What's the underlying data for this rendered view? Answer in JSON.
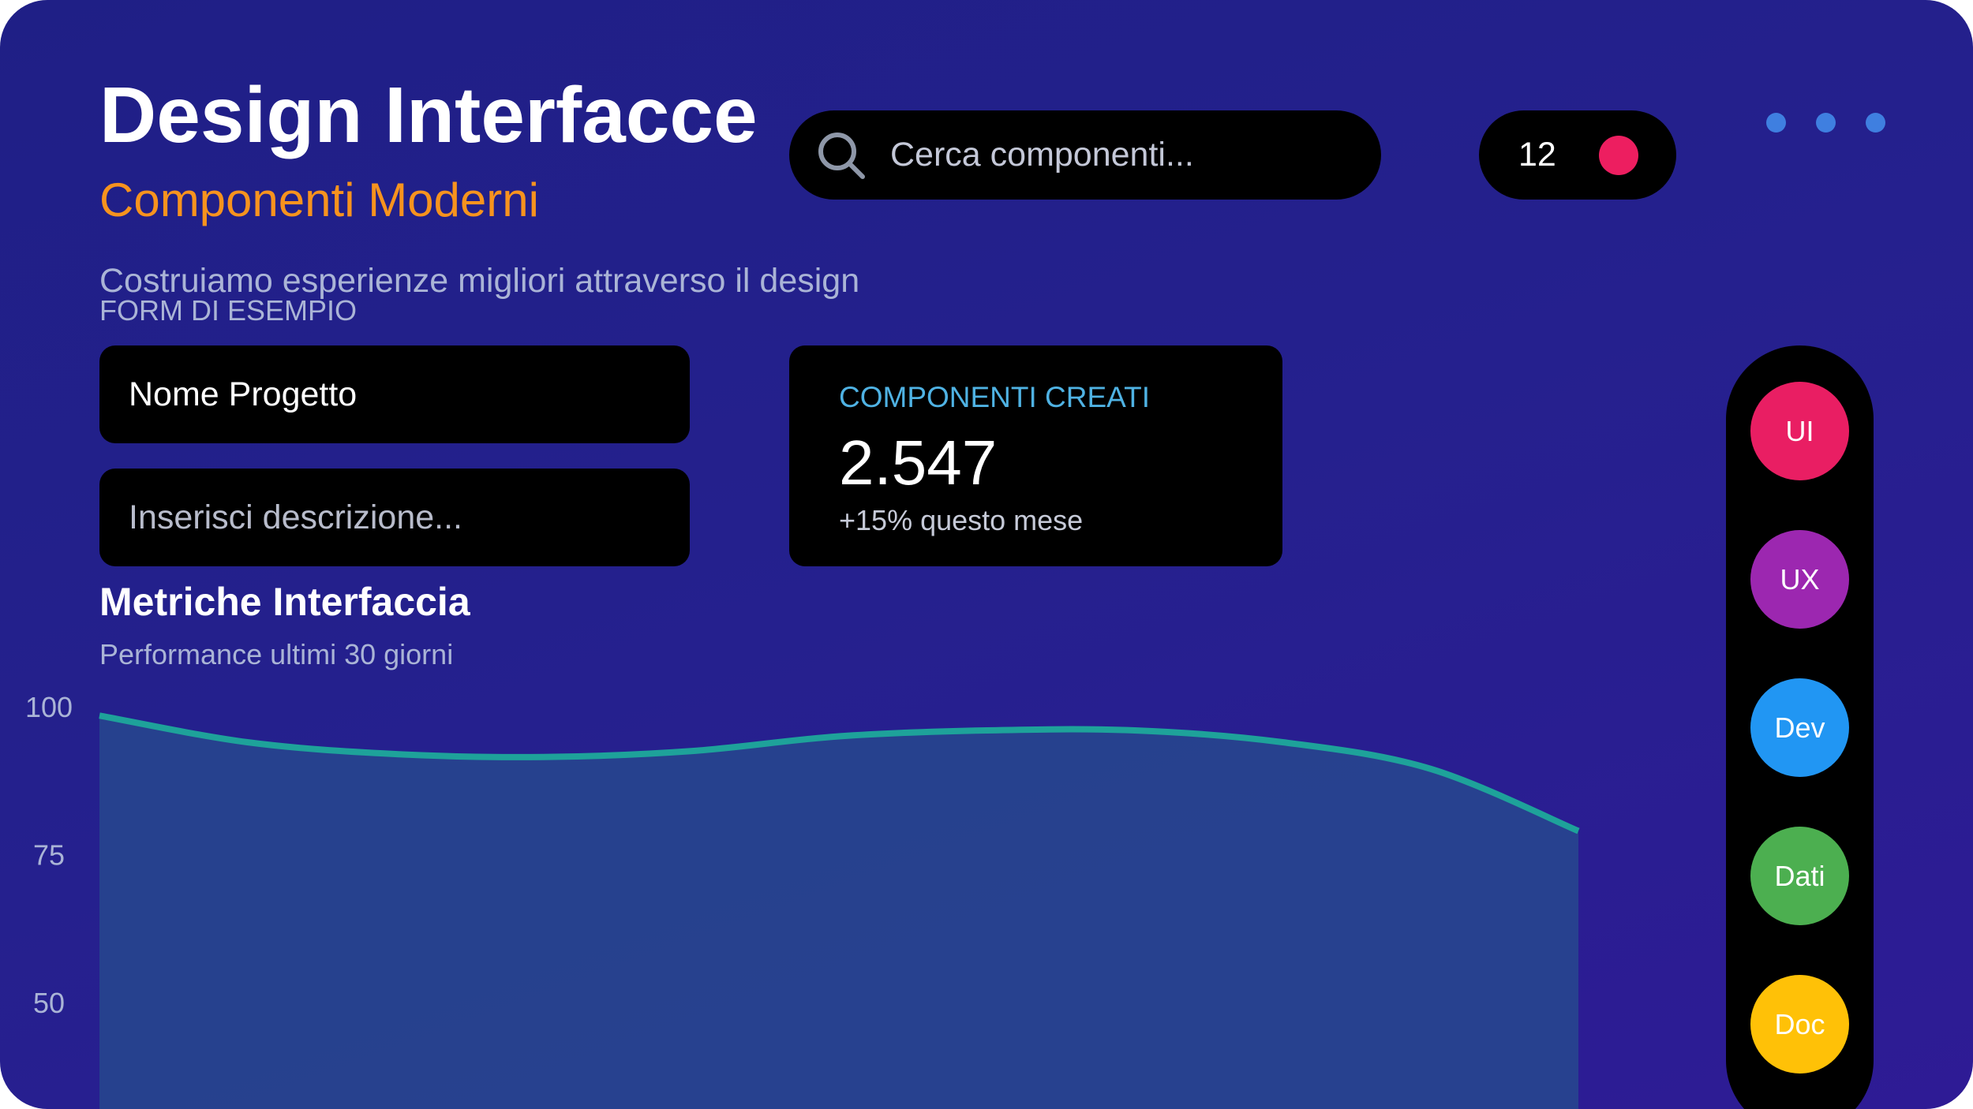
{
  "header": {
    "title": "Design Interfacce",
    "subtitle": "Componenti Moderni",
    "tagline": "Costruiamo esperienze migliori attraverso il design"
  },
  "search": {
    "placeholder": "Cerca componenti..."
  },
  "notifications": {
    "count": "12",
    "dot_color": "#ed1e60"
  },
  "form": {
    "label": "FORM DI ESEMPIO",
    "project_name": "Nome Progetto",
    "description_placeholder": "Inserisci descrizione..."
  },
  "stat_card": {
    "label": "COMPONENTI CREATI",
    "value": "2.547",
    "change": "+15% questo mese"
  },
  "metrics": {
    "title": "Metriche Interfaccia",
    "subtitle": "Performance ultimi 30 giorni"
  },
  "chart_data": {
    "type": "area",
    "title": "",
    "xlabel": "",
    "ylabel": "",
    "y_ticks": [
      "100",
      "75",
      "50"
    ],
    "ylim": [
      50,
      100
    ],
    "grid": false,
    "line_color": "#1ea29a",
    "fill_color": "#27488e",
    "series": [
      {
        "x": [
          0,
          1,
          2,
          3,
          4,
          5,
          6,
          7,
          8,
          9,
          10
        ],
        "values": [
          98.5,
          94,
          92,
          91.5,
          92.5,
          95,
          96,
          96,
          94,
          89.5,
          79
        ]
      }
    ]
  },
  "sidebar": {
    "categories": [
      {
        "label": "UI",
        "color": "#e91e63"
      },
      {
        "label": "UX",
        "color": "#9c27b0"
      },
      {
        "label": "Dev",
        "color": "#2196f3"
      },
      {
        "label": "Dati",
        "color": "#4caf50"
      },
      {
        "label": "Doc",
        "color": "#ffc107"
      }
    ]
  }
}
